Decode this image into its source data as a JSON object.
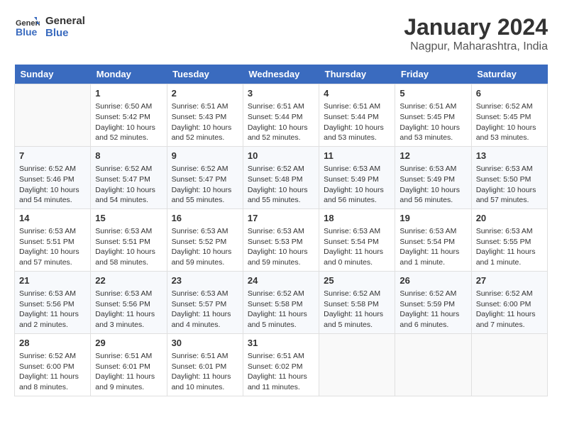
{
  "header": {
    "logo_line1": "General",
    "logo_line2": "Blue",
    "month_year": "January 2024",
    "location": "Nagpur, Maharashtra, India"
  },
  "days_of_week": [
    "Sunday",
    "Monday",
    "Tuesday",
    "Wednesday",
    "Thursday",
    "Friday",
    "Saturday"
  ],
  "weeks": [
    [
      {
        "day": "",
        "content": ""
      },
      {
        "day": "1",
        "content": "Sunrise: 6:50 AM\nSunset: 5:42 PM\nDaylight: 10 hours\nand 52 minutes."
      },
      {
        "day": "2",
        "content": "Sunrise: 6:51 AM\nSunset: 5:43 PM\nDaylight: 10 hours\nand 52 minutes."
      },
      {
        "day": "3",
        "content": "Sunrise: 6:51 AM\nSunset: 5:44 PM\nDaylight: 10 hours\nand 52 minutes."
      },
      {
        "day": "4",
        "content": "Sunrise: 6:51 AM\nSunset: 5:44 PM\nDaylight: 10 hours\nand 53 minutes."
      },
      {
        "day": "5",
        "content": "Sunrise: 6:51 AM\nSunset: 5:45 PM\nDaylight: 10 hours\nand 53 minutes."
      },
      {
        "day": "6",
        "content": "Sunrise: 6:52 AM\nSunset: 5:45 PM\nDaylight: 10 hours\nand 53 minutes."
      }
    ],
    [
      {
        "day": "7",
        "content": "Sunrise: 6:52 AM\nSunset: 5:46 PM\nDaylight: 10 hours\nand 54 minutes."
      },
      {
        "day": "8",
        "content": "Sunrise: 6:52 AM\nSunset: 5:47 PM\nDaylight: 10 hours\nand 54 minutes."
      },
      {
        "day": "9",
        "content": "Sunrise: 6:52 AM\nSunset: 5:47 PM\nDaylight: 10 hours\nand 55 minutes."
      },
      {
        "day": "10",
        "content": "Sunrise: 6:52 AM\nSunset: 5:48 PM\nDaylight: 10 hours\nand 55 minutes."
      },
      {
        "day": "11",
        "content": "Sunrise: 6:53 AM\nSunset: 5:49 PM\nDaylight: 10 hours\nand 56 minutes."
      },
      {
        "day": "12",
        "content": "Sunrise: 6:53 AM\nSunset: 5:49 PM\nDaylight: 10 hours\nand 56 minutes."
      },
      {
        "day": "13",
        "content": "Sunrise: 6:53 AM\nSunset: 5:50 PM\nDaylight: 10 hours\nand 57 minutes."
      }
    ],
    [
      {
        "day": "14",
        "content": "Sunrise: 6:53 AM\nSunset: 5:51 PM\nDaylight: 10 hours\nand 57 minutes."
      },
      {
        "day": "15",
        "content": "Sunrise: 6:53 AM\nSunset: 5:51 PM\nDaylight: 10 hours\nand 58 minutes."
      },
      {
        "day": "16",
        "content": "Sunrise: 6:53 AM\nSunset: 5:52 PM\nDaylight: 10 hours\nand 59 minutes."
      },
      {
        "day": "17",
        "content": "Sunrise: 6:53 AM\nSunset: 5:53 PM\nDaylight: 10 hours\nand 59 minutes."
      },
      {
        "day": "18",
        "content": "Sunrise: 6:53 AM\nSunset: 5:54 PM\nDaylight: 11 hours\nand 0 minutes."
      },
      {
        "day": "19",
        "content": "Sunrise: 6:53 AM\nSunset: 5:54 PM\nDaylight: 11 hours\nand 1 minute."
      },
      {
        "day": "20",
        "content": "Sunrise: 6:53 AM\nSunset: 5:55 PM\nDaylight: 11 hours\nand 1 minute."
      }
    ],
    [
      {
        "day": "21",
        "content": "Sunrise: 6:53 AM\nSunset: 5:56 PM\nDaylight: 11 hours\nand 2 minutes."
      },
      {
        "day": "22",
        "content": "Sunrise: 6:53 AM\nSunset: 5:56 PM\nDaylight: 11 hours\nand 3 minutes."
      },
      {
        "day": "23",
        "content": "Sunrise: 6:53 AM\nSunset: 5:57 PM\nDaylight: 11 hours\nand 4 minutes."
      },
      {
        "day": "24",
        "content": "Sunrise: 6:52 AM\nSunset: 5:58 PM\nDaylight: 11 hours\nand 5 minutes."
      },
      {
        "day": "25",
        "content": "Sunrise: 6:52 AM\nSunset: 5:58 PM\nDaylight: 11 hours\nand 5 minutes."
      },
      {
        "day": "26",
        "content": "Sunrise: 6:52 AM\nSunset: 5:59 PM\nDaylight: 11 hours\nand 6 minutes."
      },
      {
        "day": "27",
        "content": "Sunrise: 6:52 AM\nSunset: 6:00 PM\nDaylight: 11 hours\nand 7 minutes."
      }
    ],
    [
      {
        "day": "28",
        "content": "Sunrise: 6:52 AM\nSunset: 6:00 PM\nDaylight: 11 hours\nand 8 minutes."
      },
      {
        "day": "29",
        "content": "Sunrise: 6:51 AM\nSunset: 6:01 PM\nDaylight: 11 hours\nand 9 minutes."
      },
      {
        "day": "30",
        "content": "Sunrise: 6:51 AM\nSunset: 6:01 PM\nDaylight: 11 hours\nand 10 minutes."
      },
      {
        "day": "31",
        "content": "Sunrise: 6:51 AM\nSunset: 6:02 PM\nDaylight: 11 hours\nand 11 minutes."
      },
      {
        "day": "",
        "content": ""
      },
      {
        "day": "",
        "content": ""
      },
      {
        "day": "",
        "content": ""
      }
    ]
  ]
}
